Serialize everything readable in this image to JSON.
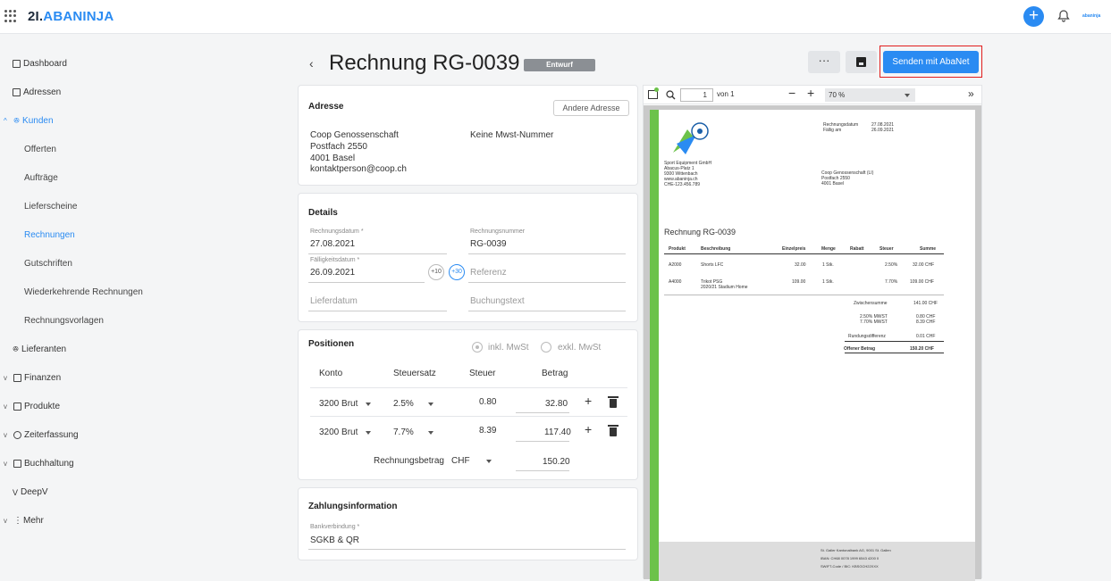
{
  "app": {
    "logo_prefix": "2I.",
    "logo_name": "ABANINJA",
    "mini_logo": "abaninja"
  },
  "sidebar": {
    "items": [
      {
        "label": "Dashboard"
      },
      {
        "label": "Adressen"
      },
      {
        "label": "Kunden"
      },
      {
        "label": "Offerten"
      },
      {
        "label": "Aufträge"
      },
      {
        "label": "Lieferscheine"
      },
      {
        "label": "Rechnungen"
      },
      {
        "label": "Gutschriften"
      },
      {
        "label": "Wiederkehrende Rechnungen"
      },
      {
        "label": "Rechnungsvorlagen"
      },
      {
        "label": "Lieferanten"
      },
      {
        "label": "Finanzen"
      },
      {
        "label": "Produkte"
      },
      {
        "label": "Zeiterfassung"
      },
      {
        "label": "Buchhaltung"
      },
      {
        "label": "DeepV"
      },
      {
        "label": "Mehr"
      }
    ]
  },
  "header": {
    "title": "Rechnung RG-0039",
    "status": "Entwurf",
    "more": "···",
    "send_label": "Senden mit AbaNet"
  },
  "address": {
    "title": "Adresse",
    "other_btn": "Andere Adresse",
    "lines": [
      "Coop Genossenschaft",
      "Postfach 2550",
      "4001 Basel",
      "kontaktperson@coop.ch"
    ],
    "vat": "Keine Mwst-Nummer"
  },
  "details": {
    "title": "Details",
    "invoice_date_label": "Rechnungsdatum *",
    "invoice_date": "27.08.2021",
    "invoice_no_label": "Rechnungsnummer",
    "invoice_no": "RG-0039",
    "due_label": "Fälligkeitsdatum *",
    "due": "26.09.2021",
    "plus10": "+10",
    "plus30": "+30",
    "reference_ph": "Referenz",
    "delivery_ph": "Lieferdatum",
    "booking_ph": "Buchungstext"
  },
  "positions": {
    "title": "Positionen",
    "incl": "inkl. MwSt",
    "excl": "exkl. MwSt",
    "headers": [
      "Konto",
      "Steuersatz",
      "Steuer",
      "Betrag"
    ],
    "rows": [
      {
        "konto": "3200 Brut",
        "rate": "2.5%",
        "tax": "0.80",
        "amount": "32.80"
      },
      {
        "konto": "3200 Brut",
        "rate": "7.7%",
        "tax": "8.39",
        "amount": "117.40"
      }
    ],
    "total_label": "Rechnungsbetrag",
    "currency": "CHF",
    "total": "150.20"
  },
  "payment": {
    "title": "Zahlungsinformation",
    "bank_label": "Bankverbindung *",
    "bank": "SGKB & QR"
  },
  "pdf": {
    "page_input": "1",
    "of_label": "von 1",
    "zoom": "70 %",
    "sender": [
      "Sport Equipment GmbH",
      "Abacus-Platz 1",
      "9300 Wittenbach",
      "www.abaninja.ch",
      "CHE-123.456.789"
    ],
    "meta": [
      [
        "Rechnungsdatum",
        "27.08.2021"
      ],
      [
        "Fällig am",
        "26.09.2021"
      ]
    ],
    "recipient": [
      "Coop Genossenschaft (LI)",
      "Postfach 2550",
      "4001 Basel"
    ],
    "doc_title": "Rechnung RG-0039",
    "cols": [
      "Produkt",
      "Beschreibung",
      "Einzelpreis",
      "Menge",
      "Rabatt",
      "Steuer",
      "Summe"
    ],
    "items": [
      {
        "p": "A2000",
        "d": "Shorts LFC",
        "d2": "",
        "ep": "32.00",
        "m": "1 Stk.",
        "st": "2.50%",
        "s": "32.00 CHF"
      },
      {
        "p": "A4000",
        "d": "Trikot PSG",
        "d2": "2020/21 Stadium Home",
        "ep": "109.00",
        "m": "1 Stk.",
        "st": "7.70%",
        "s": "109.00 CHF"
      }
    ],
    "subtotal_label": "Zwischensumme",
    "subtotal": "141.00 CHF",
    "vat1_label": "2.50% MWST",
    "vat1": "0.80 CHF",
    "vat2_label": "7.70% MWST",
    "vat2": "8.39 CHF",
    "round_label": "Rundungsdifferenz",
    "round": "0.01 CHF",
    "open_label": "Offener Betrag",
    "open": "150.20 CHF",
    "footer": [
      "St. Galler Kantonalbank AG, 9001 St. Gallen",
      "IBAN: CH68 0078 1999 6543 4200 0",
      "SWIFT-Code / BIC: KBSGCH22XXX"
    ]
  },
  "colors": {
    "accent": "#2a8bf2",
    "green": "#6cc24a",
    "highlight": "#e11d1d"
  }
}
